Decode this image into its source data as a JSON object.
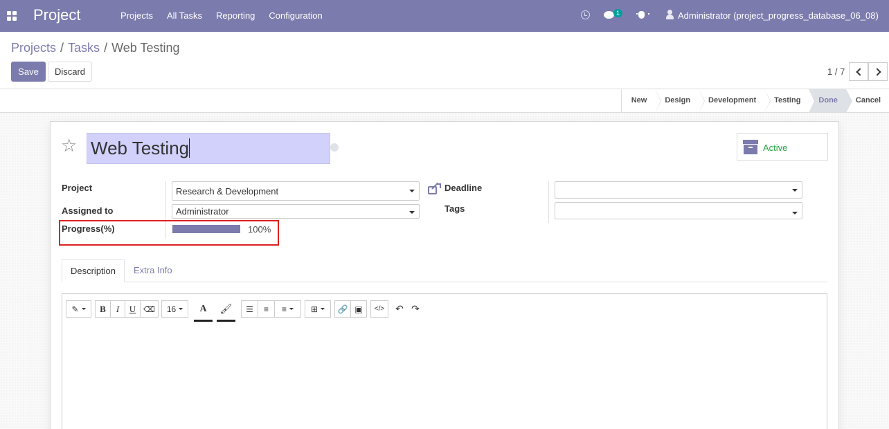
{
  "navbar": {
    "brand": "Project",
    "menu": [
      "Projects",
      "All Tasks",
      "Reporting",
      "Configuration"
    ],
    "chat_badge": "1",
    "user": "Administrator (project_progress_database_06_08)"
  },
  "breadcrumb": {
    "items": [
      "Projects",
      "Tasks"
    ],
    "current": "Web Testing",
    "separator": "/"
  },
  "buttons": {
    "save": "Save",
    "discard": "Discard"
  },
  "pager": {
    "value": "1 / 7"
  },
  "stages": {
    "items": [
      "New",
      "Design",
      "Development",
      "Testing",
      "Done",
      "Cancel"
    ],
    "current": "Done"
  },
  "task": {
    "title": "Web Testing",
    "active_label": "Active"
  },
  "fields": {
    "project_label": "Project",
    "project_value": "Research & Development",
    "assigned_label": "Assigned to",
    "assigned_value": "Administrator",
    "progress_label": "Progress(%)",
    "progress_text": "100%",
    "progress_fraction": 1.0,
    "deadline_label": "Deadline",
    "deadline_value": "",
    "tags_label": "Tags",
    "tags_value": ""
  },
  "tabs": [
    "Description",
    "Extra Info"
  ],
  "editor_toolbar": {
    "font_size": "16",
    "bold": "B",
    "italic": "I",
    "underline": "U",
    "font_color": "A",
    "code": "</>"
  },
  "colors": {
    "brand": "#7c7bad",
    "active_green": "#28a745",
    "highlight_red": "#dd2222",
    "title_bg": "#d1d1fb"
  }
}
